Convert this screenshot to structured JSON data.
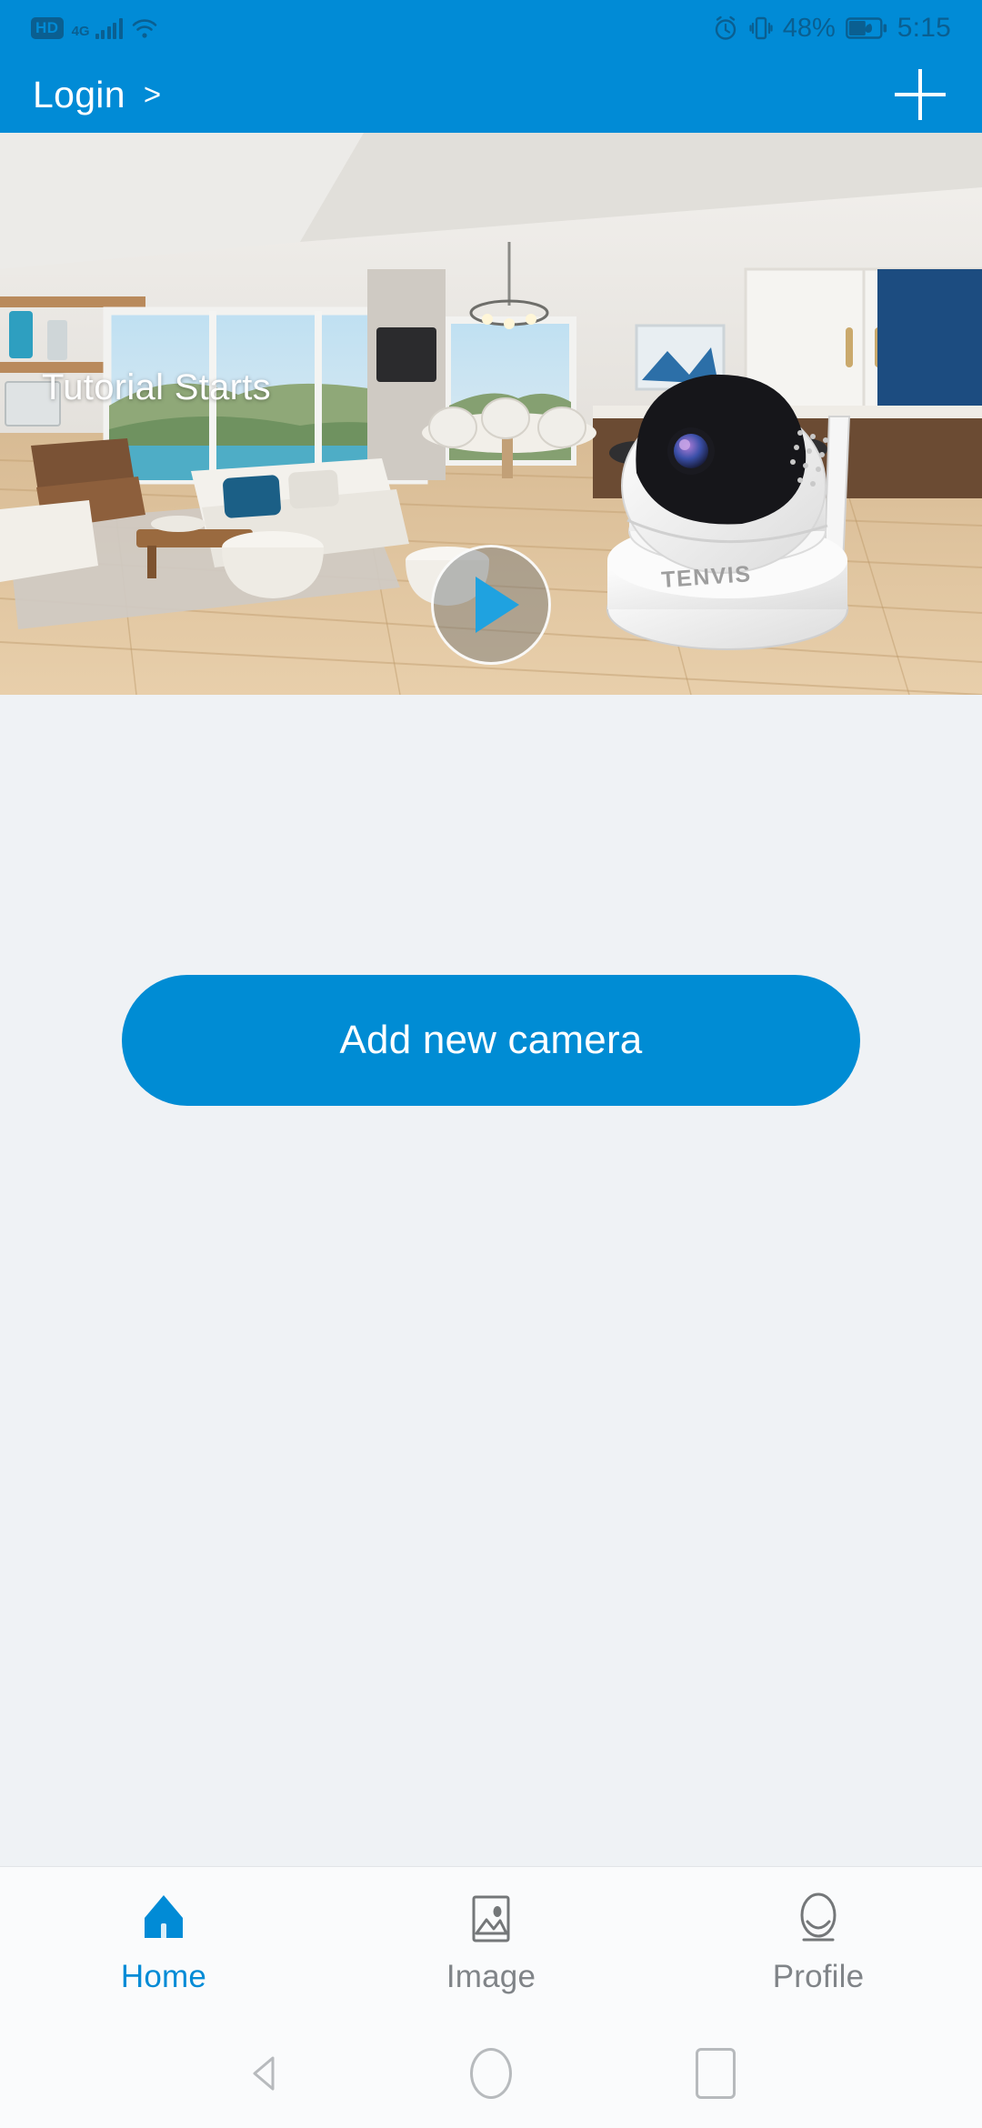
{
  "status_bar": {
    "hd_badge": "HD",
    "network_type": "4G",
    "signal_icon": "signal-bars-icon",
    "wifi_icon": "wifi-icon",
    "alarm_icon": "alarm-clock-icon",
    "vibrate_icon": "vibrate-icon",
    "battery_percent": "48%",
    "battery_icon": "battery-saver-icon",
    "time": "5:15"
  },
  "header": {
    "login_label": "Login",
    "login_arrow": ">",
    "add_icon": "plus-icon"
  },
  "hero": {
    "overlay_label": "Tutorial Starts",
    "play_icon": "play-icon",
    "camera_brand": "TENVIS",
    "scene_description": "Modern open-plan living room with wood floors and a white pan-tilt security camera"
  },
  "main": {
    "add_camera_label": "Add new camera"
  },
  "tab_bar": {
    "items": [
      {
        "label": "Home",
        "icon": "home-icon",
        "active": true
      },
      {
        "label": "Image",
        "icon": "image-icon",
        "active": false
      },
      {
        "label": "Profile",
        "icon": "profile-icon",
        "active": false
      }
    ]
  },
  "nav_bar": {
    "back": "back-triangle-icon",
    "home": "home-circle-icon",
    "recents": "recents-square-icon"
  },
  "colors": {
    "brand_blue": "#018BD6",
    "button_blue": "#008CD4",
    "page_bg": "#eff2f5",
    "tab_inactive": "#808488"
  }
}
